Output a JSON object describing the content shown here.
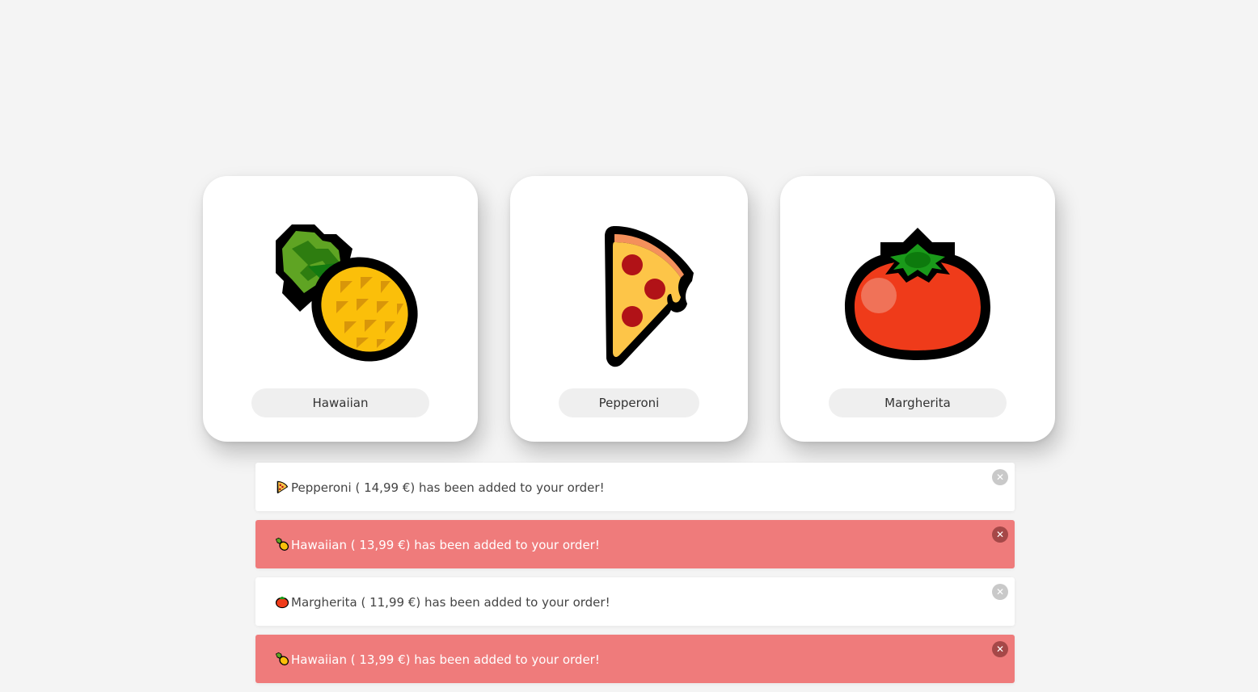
{
  "products": [
    {
      "name": "Hawaiian",
      "icon": "pineapple-icon"
    },
    {
      "name": "Pepperoni",
      "icon": "pizza-icon"
    },
    {
      "name": "Margherita",
      "icon": "tomato-icon"
    }
  ],
  "notifications": [
    {
      "variant": "plain",
      "icon": "pizza-icon",
      "message": "Pepperoni ( 14,99 €) has been added to your order!",
      "close": "✕"
    },
    {
      "variant": "alert",
      "icon": "pineapple-icon",
      "message": "Hawaiian ( 13,99 €) has been added to your order!",
      "close": "✕"
    },
    {
      "variant": "plain",
      "icon": "tomato-icon",
      "message": "Margherita ( 11,99 €) has been added to your order!",
      "close": "✕"
    },
    {
      "variant": "alert",
      "icon": "pineapple-icon",
      "message": "Hawaiian ( 13,99 €) has been added to your order!",
      "close": "✕"
    }
  ],
  "colors": {
    "background": "#f4f4f4",
    "card": "#ffffff",
    "pill": "#efefef",
    "alert": "#ef7b7b",
    "alert_close": "#a54848",
    "close": "#c9c9c9"
  }
}
